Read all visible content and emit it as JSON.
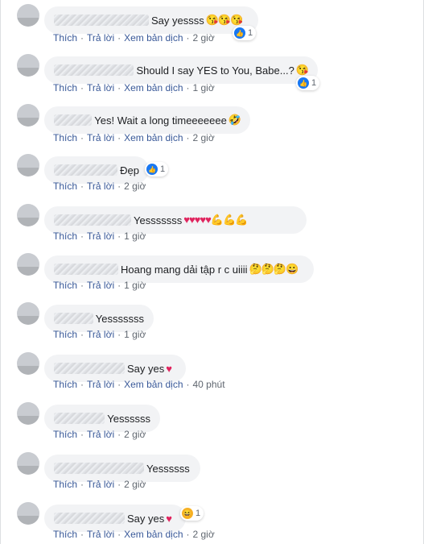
{
  "labels": {
    "like": "Thích",
    "reply": "Trả lời",
    "translate": "Xem bản dịch"
  },
  "comments": [
    {
      "text": "Say yessss",
      "emojis": "😘😘😘",
      "time": "2 giờ",
      "reaction_count": "1",
      "reaction": "like"
    },
    {
      "text": "Should I say YES to You, Babe...?",
      "emojis": "😘",
      "time": "1 giờ",
      "reaction_count": "1",
      "reaction": "like"
    },
    {
      "text": "Yes! Wait a long timeeeeeee",
      "emojis": "🤣",
      "time": "2 giờ"
    },
    {
      "text": "Đẹp",
      "emojis": "",
      "time": "2 giờ",
      "reaction_count": "1",
      "reaction": "like"
    },
    {
      "text": "Yesssssss",
      "emojis": "♥♥♥♥♥💪💪💪",
      "time": "1 giờ"
    },
    {
      "text": "Hoang mang dải tập r c uiiii",
      "emojis": "🤔🤔🤔😀",
      "time": "1 giờ"
    },
    {
      "text": "Yesssssss",
      "emojis": "",
      "time": "1 giờ"
    },
    {
      "text": "Say yes",
      "emojis": "♥",
      "time": "40 phút"
    },
    {
      "text": "Yessssss",
      "emojis": "",
      "time": "2 giờ"
    },
    {
      "text": "Yessssss",
      "emojis": "",
      "time": "2 giờ"
    },
    {
      "text": "Say yes",
      "emojis": "♥",
      "time": "2 giờ",
      "reaction_count": "1",
      "reaction": "haha"
    }
  ],
  "colors": {
    "link": "#385898",
    "bubble": "#f2f3f5",
    "meta": "#606770",
    "like_blue": "#1877f2"
  }
}
